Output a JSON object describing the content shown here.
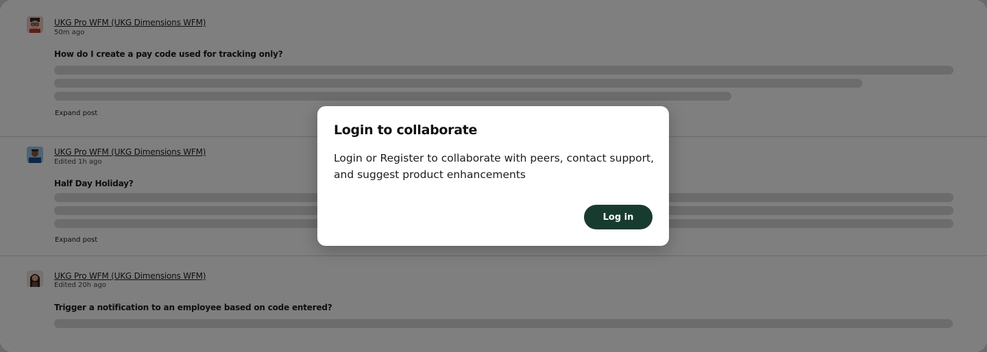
{
  "feed": {
    "posts": [
      {
        "author": "UKG Pro WFM (UKG Dimensions WFM)",
        "time": "50m ago",
        "title": "How do I create a pay code used for tracking only?",
        "expand_label": "Expand post",
        "avatar_icon": "user-avatar-glasses"
      },
      {
        "author": "UKG Pro WFM (UKG Dimensions WFM)",
        "time": "Edited 1h ago",
        "title": "Half Day Holiday?",
        "expand_label": "Expand post",
        "avatar_icon": "user-avatar-blue"
      },
      {
        "author": "UKG Pro WFM (UKG Dimensions WFM)",
        "time": "Edited 20h ago",
        "title": "Trigger a notification to an employee based on code entered?",
        "avatar_icon": "user-avatar-woman"
      }
    ]
  },
  "modal": {
    "title": "Login to collaborate",
    "body": "Login or Register to collaborate with peers, contact support, and suggest product enhancements",
    "login_label": "Log in"
  },
  "colors": {
    "overlay": "rgba(0,0,0,0.5)",
    "button": "#183b30",
    "skeleton": "#d8d8d8"
  }
}
